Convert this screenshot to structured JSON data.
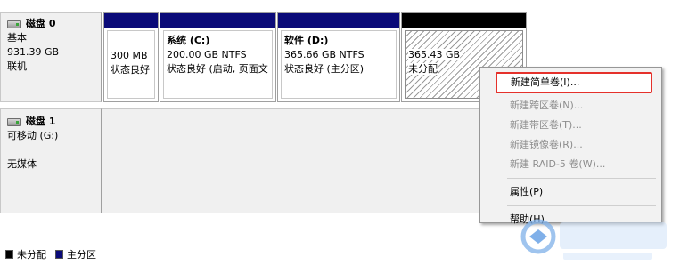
{
  "disk0": {
    "title": "磁盘 0",
    "type": "基本",
    "size": "931.39 GB",
    "status": "联机",
    "partitions": [
      {
        "name": "",
        "size": "300 MB",
        "status": "状态良好"
      },
      {
        "name": "系统  (C:)",
        "size": "200.00 GB NTFS",
        "status": "状态良好 (启动, 页面文"
      },
      {
        "name": "软件  (D:)",
        "size": "365.66 GB NTFS",
        "status": "状态良好 (主分区)"
      },
      {
        "name": "",
        "size": "365.43 GB",
        "status": "未分配"
      }
    ]
  },
  "disk1": {
    "title": "磁盘 1",
    "type": "可移动 (G:)",
    "media": "无媒体"
  },
  "legend": {
    "unallocated": "未分配",
    "primary": "主分区",
    "colors": {
      "unallocated": "#000000",
      "primary": "#0a0a78"
    }
  },
  "context_menu": {
    "items": [
      {
        "label": "新建简单卷(I)...",
        "enabled": true,
        "highlighted": true
      },
      {
        "label": "新建跨区卷(N)...",
        "enabled": false
      },
      {
        "label": "新建带区卷(T)...",
        "enabled": false
      },
      {
        "label": "新建镜像卷(R)...",
        "enabled": false
      },
      {
        "label": "新建 RAID-5 卷(W)...",
        "enabled": false
      },
      {
        "label": "属性(P)",
        "enabled": true
      },
      {
        "label": "帮助(H)",
        "enabled": true
      }
    ],
    "highlight_color": "#e5312b"
  }
}
